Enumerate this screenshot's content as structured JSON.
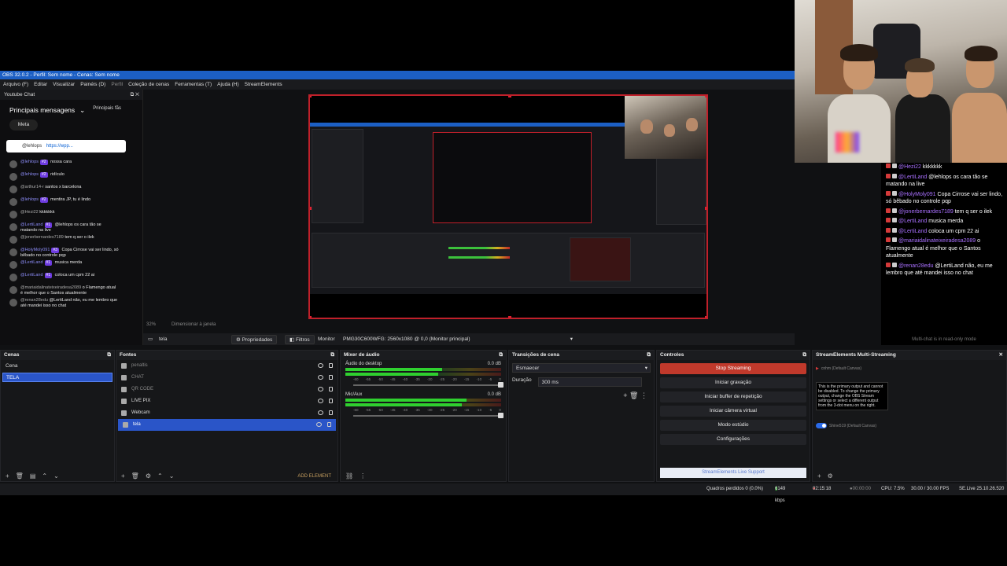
{
  "window": {
    "title": "OBS 32.0.2 - Perfil: Sem nome - Cenas: Sem nome"
  },
  "menu": [
    "Arquivo (F)",
    "Editar",
    "Visualizar",
    "Painéis (D)",
    "Perfil",
    "Coleção de cenas",
    "Ferramentas (T)",
    "Ajuda (H)",
    "StreamElements"
  ],
  "youtube_chat": {
    "dock_title": "Youtube Chat",
    "heading": "Principais mensagens",
    "heading_option": "Principais fãs",
    "meta_button": "Meta",
    "pinned_user": "@lehlops",
    "pinned_link": "https://wpp...",
    "messages": [
      {
        "user": "@lehlops",
        "badge": "#2",
        "text": "nossa cara",
        "grey": false
      },
      {
        "user": "@lehlops",
        "badge": "#2",
        "text": "ridículo",
        "grey": false
      },
      {
        "user": "@arthur14-r",
        "badge": "",
        "text": "santos x barcelona",
        "grey": true
      },
      {
        "user": "@lehlops",
        "badge": "#2",
        "text": "mentira JP, tu é lindo",
        "grey": false
      },
      {
        "user": "@Hezi22",
        "badge": "",
        "text": "kkkkkkk",
        "grey": true
      },
      {
        "user": "@LertiLand",
        "badge": "#1",
        "text": "@lehlops os cara tão se matando na live",
        "grey": false
      },
      {
        "user": "@jonerbernardes7189",
        "badge": "",
        "text": "tem q ser o ilek",
        "grey": true
      },
      {
        "user": "@HolyMoly091",
        "badge": "#3",
        "text": "Copa Cirrose vai ser lindo, só bêbado no controle pqp",
        "grey": false
      },
      {
        "user": "@LertiLand",
        "badge": "#1",
        "text": "musica merda",
        "grey": false
      },
      {
        "user": "@LertiLand",
        "badge": "#1",
        "text": "coloca um cpm 22 ai",
        "grey": false
      },
      {
        "user": "@mariaidalinateixeiradesa2089",
        "badge": "",
        "text": "o Flamengo atual é melhor que o Santos atualmente",
        "grey": true
      },
      {
        "user": "@renan28edu",
        "badge": "",
        "text": "@LertiLand não, eu me lembro que até mandei isso no chat",
        "grey": true
      }
    ]
  },
  "preview": {
    "zoom": "32%",
    "resize_label": "Dimensionar à janela"
  },
  "source_bar": {
    "source_name": "tela",
    "properties": "Propriedades",
    "filters": "Filtros",
    "monitor_label": "Monitor",
    "monitor_value": "PMG30C600WFG: 2560x1080 @ 0,0 (Monitor principal)"
  },
  "scenes": {
    "title": "Cenas",
    "items": [
      "Cena",
      "TELA"
    ],
    "selected": 1
  },
  "sources": {
    "title": "Fontes",
    "items": [
      {
        "name": "penaltis",
        "dim": true
      },
      {
        "name": "CHAT",
        "dim": true
      },
      {
        "name": "QR CODE",
        "dim": true
      },
      {
        "name": "LIVE PIX",
        "dim": false
      },
      {
        "name": "Webcam",
        "dim": false
      },
      {
        "name": "tela",
        "dim": false
      }
    ],
    "add_element": "ADD ELEMENT"
  },
  "mixer": {
    "title": "Mixer de áudio",
    "channels": [
      {
        "name": "Áudio do desktop",
        "db": "0.0 dB",
        "level": 0.62
      },
      {
        "name": "Mic/Aux",
        "db": "0.0 dB",
        "level": 0.78
      }
    ],
    "ticks": [
      "-60",
      "-55",
      "-50",
      "-45",
      "-40",
      "-35",
      "-30",
      "-25",
      "-20",
      "-15",
      "-10",
      "-5",
      "0"
    ]
  },
  "transitions": {
    "title": "Transições de cena",
    "type": "Esmaecer",
    "duration_label": "Duração",
    "duration": "300 ms"
  },
  "controls": {
    "title": "Controles",
    "buttons": [
      "Stop Streaming",
      "Iniciar gravação",
      "Iniciar buffer de repetição",
      "Iniciar câmera virtual",
      "Modo estúdio",
      "Configurações"
    ],
    "footer": "StreamElements Live Support"
  },
  "multistreaming": {
    "title": "StreamElements Multi-Streaming",
    "tooltip": "This is the primary output and cannot be disabled. To change the primary output, change the OBS Stream settings or select a different output from the 3-dot menu on the right.",
    "row1": "cnhm (Default Canvas)",
    "row2": "Shine519 (Default Canvas)"
  },
  "status": {
    "dropped": "Quadros perdidos 0 (0.0%)",
    "bitrate": "6149 kbps",
    "live_time": "02:15:18",
    "rec_time": "00:00:00",
    "cpu": "CPU: 7.5%",
    "fps": "30.00 / 30.00 FPS",
    "version": "SE.Live 25.10.26.520"
  },
  "multichat": {
    "messages": [
      {
        "user": "@Hezi22",
        "text": "kkkkkkk"
      },
      {
        "user": "@LertiLand",
        "text": "@lehlops os cara tão se matando na live"
      },
      {
        "user": "@HolyMoly091",
        "text": "Copa Cirrose vai ser lindo, só bêbado no controle pqp"
      },
      {
        "user": "@jonerbernardes7189",
        "text": "tem q ser o ilek"
      },
      {
        "user": "@LertiLand",
        "text": "musica merda"
      },
      {
        "user": "@LertiLand",
        "text": "coloca um cpm 22 ai"
      },
      {
        "user": "@mariaidalinateixeiradesa2089",
        "text": "o Flamengo atual é melhor que o Santos atualmente"
      },
      {
        "user": "@renan28edu",
        "text": "@LertiLand não, eu me lembro que até mandei isso no chat"
      }
    ],
    "footer": "Multi-chat is in read-only mode"
  },
  "colors": {
    "accent": "#2a55c8",
    "stop": "#c0392b",
    "preview_border": "#c0202a",
    "titlebar": "#1c5fc4"
  }
}
